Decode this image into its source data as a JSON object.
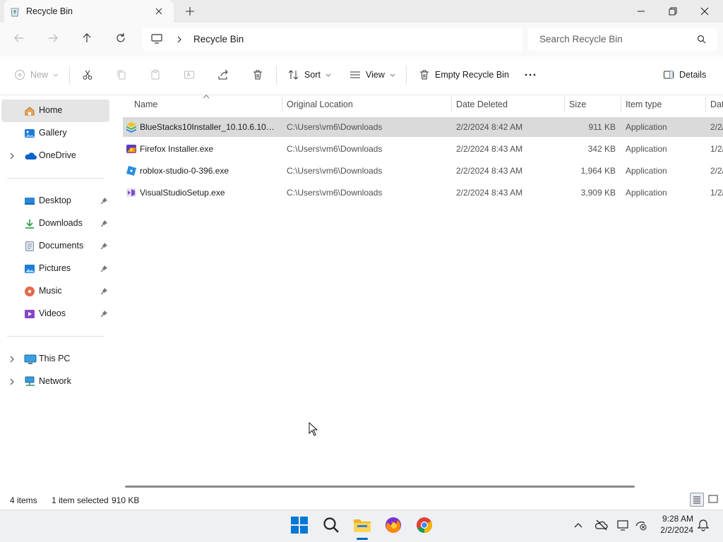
{
  "window": {
    "tab_title": "Recycle Bin",
    "new_tab": "+"
  },
  "address": {
    "breadcrumb": "Recycle Bin",
    "search_placeholder": "Search Recycle Bin"
  },
  "commandbar": {
    "new_label": "New",
    "sort_label": "Sort",
    "view_label": "View",
    "empty_label": "Empty Recycle Bin",
    "details_label": "Details"
  },
  "sidebar": {
    "items": [
      {
        "label": "Home",
        "icon": "home-icon"
      },
      {
        "label": "Gallery",
        "icon": "gallery-icon"
      },
      {
        "label": "OneDrive",
        "icon": "onedrive-icon"
      },
      {
        "label": "Desktop",
        "icon": "desktop-icon"
      },
      {
        "label": "Downloads",
        "icon": "downloads-icon"
      },
      {
        "label": "Documents",
        "icon": "documents-icon"
      },
      {
        "label": "Pictures",
        "icon": "pictures-icon"
      },
      {
        "label": "Music",
        "icon": "music-icon"
      },
      {
        "label": "Videos",
        "icon": "videos-icon"
      },
      {
        "label": "This PC",
        "icon": "this-pc-icon"
      },
      {
        "label": "Network",
        "icon": "network-icon"
      }
    ]
  },
  "columns": [
    "Name",
    "Original Location",
    "Date Deleted",
    "Size",
    "Item type",
    "Dat"
  ],
  "files": [
    {
      "name": "BlueStacks10Installer_10.10.6.1001_...",
      "location": "C:\\Users\\vm6\\Downloads",
      "deleted": "2/2/2024 8:42 AM",
      "size": "911 KB",
      "type": "Application",
      "date": "2/2/",
      "icon": "bluestacks-icon"
    },
    {
      "name": "Firefox Installer.exe",
      "location": "C:\\Users\\vm6\\Downloads",
      "deleted": "2/2/2024 8:43 AM",
      "size": "342 KB",
      "type": "Application",
      "date": "1/2/",
      "icon": "firefox-installer-icon"
    },
    {
      "name": "roblox-studio-0-396.exe",
      "location": "C:\\Users\\vm6\\Downloads",
      "deleted": "2/2/2024 8:43 AM",
      "size": "1,964 KB",
      "type": "Application",
      "date": "2/2/",
      "icon": "roblox-icon"
    },
    {
      "name": "VisualStudioSetup.exe",
      "location": "C:\\Users\\vm6\\Downloads",
      "deleted": "2/2/2024 8:43 AM",
      "size": "3,909 KB",
      "type": "Application",
      "date": "1/2/",
      "icon": "visual-studio-icon"
    }
  ],
  "status": {
    "items": "4 items",
    "selected": "1 item selected",
    "size": "910 KB"
  },
  "taskbar": {
    "time": "9:28 AM",
    "date": "2/2/2024"
  },
  "colors": {
    "accent": "#0067c0",
    "selection": "#dadada",
    "windows_blue": "#0078d4"
  }
}
